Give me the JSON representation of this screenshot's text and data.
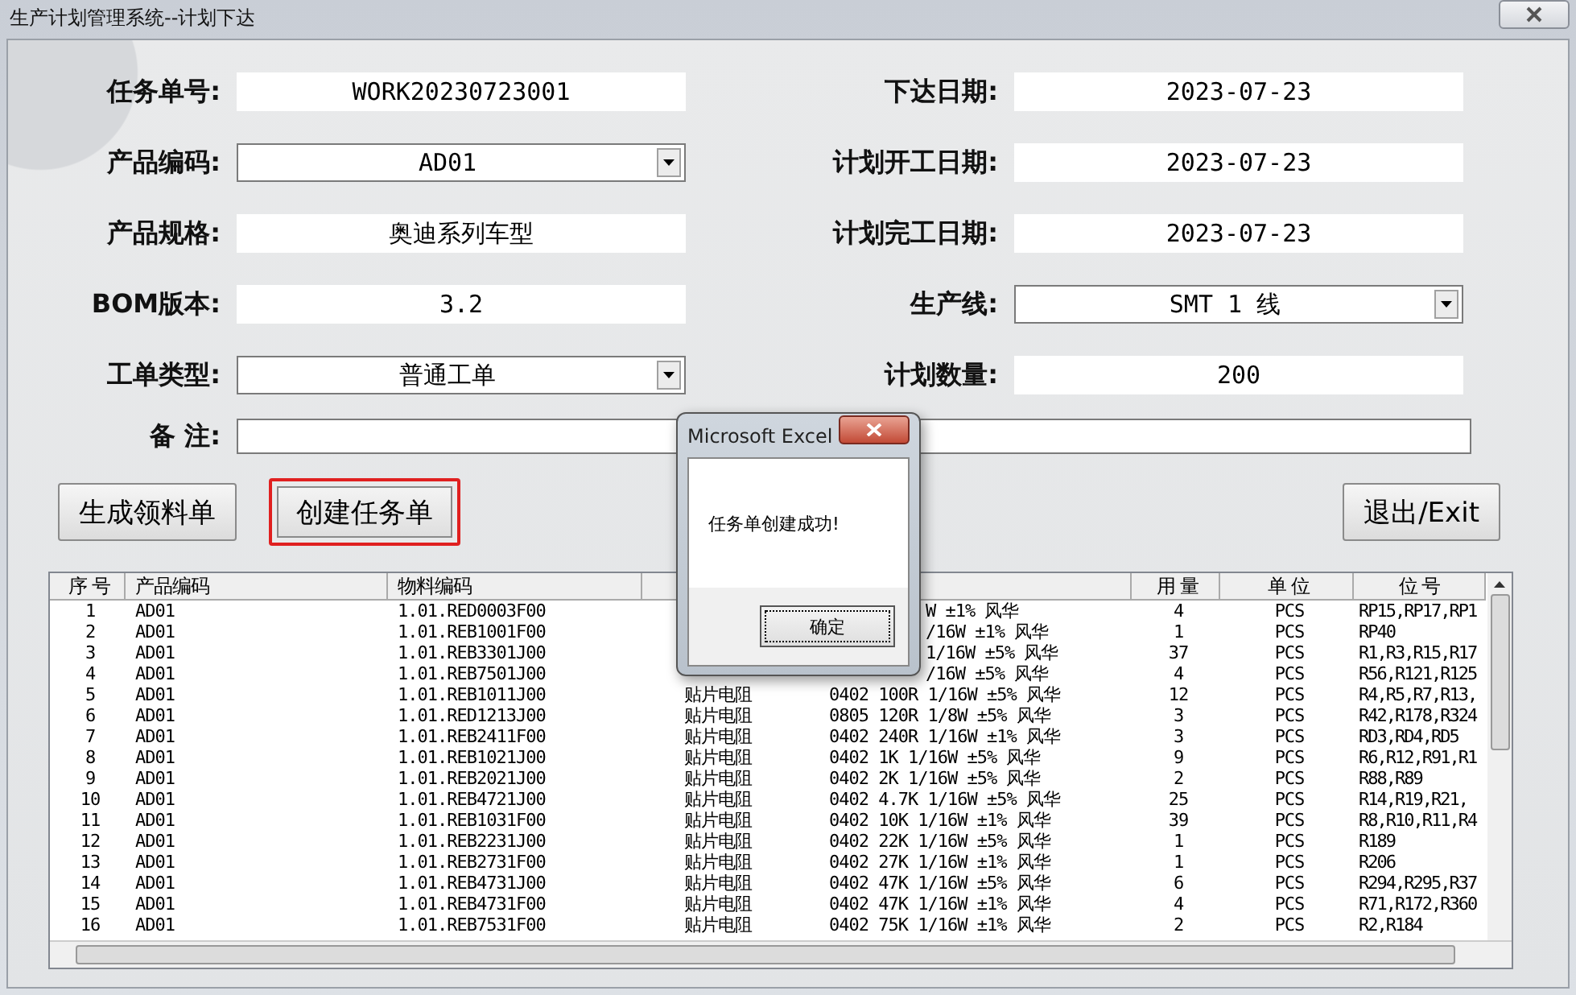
{
  "window": {
    "title": "生产计划管理系统--计划下达"
  },
  "form": {
    "left": [
      {
        "label": "任务单号:",
        "kind": "text",
        "value": "WORK20230723001"
      },
      {
        "label": "产品编码:",
        "kind": "dropdown",
        "value": "AD01"
      },
      {
        "label": "产品规格:",
        "kind": "text",
        "value": "奥迪系列车型"
      },
      {
        "label": "BOM版本:",
        "kind": "text",
        "value": "3.2"
      },
      {
        "label": "工单类型:",
        "kind": "dropdown",
        "value": "普通工单"
      }
    ],
    "right": [
      {
        "label": "下达日期:",
        "kind": "text",
        "value": "2023-07-23"
      },
      {
        "label": "计划开工日期:",
        "kind": "text",
        "value": "2023-07-23"
      },
      {
        "label": "计划完工日期:",
        "kind": "text",
        "value": "2023-07-23"
      },
      {
        "label": "生产线:",
        "kind": "dropdown",
        "value": "SMT 1 线"
      },
      {
        "label": "计划数量:",
        "kind": "text",
        "value": "200"
      }
    ],
    "memo": {
      "label": "备 注:"
    }
  },
  "buttons": [
    {
      "label": "生成领料单",
      "focused": false
    },
    {
      "label": "创建任务单",
      "focused": true
    },
    {
      "label": "退出/Exit",
      "focused": false
    }
  ],
  "table": {
    "columns": [
      "序 号",
      "产品编码",
      "物料编码",
      "用 量",
      "单 位",
      "位 号"
    ],
    "rows": [
      {
        "no": "1",
        "product": "AD01",
        "material": "1.01.RED0003F00",
        "spec": "W ±1% 风华",
        "qty": "4",
        "unit": "PCS",
        "position": "RP15,RP17,RP1"
      },
      {
        "no": "2",
        "product": "AD01",
        "material": "1.01.REB1001F00",
        "spec": "/16W ±1% 风华",
        "qty": "1",
        "unit": "PCS",
        "position": "RP40"
      },
      {
        "no": "3",
        "product": "AD01",
        "material": "1.01.REB3301J00",
        "spec": "1/16W ±5% 风华",
        "qty": "37",
        "unit": "PCS",
        "position": "R1,R3,R15,R17"
      },
      {
        "no": "4",
        "product": "AD01",
        "material": "1.01.REB7501J00",
        "spec": "/16W ±5% 风华",
        "qty": "4",
        "unit": "PCS",
        "position": "R56,R121,R125"
      },
      {
        "no": "5",
        "product": "AD01",
        "material": "1.01.REB1011J00",
        "name": "贴片电阻",
        "spec": "0402 100R 1/16W ±5% 风华",
        "qty": "12",
        "unit": "PCS",
        "position": "R4,R5,R7,R13,"
      },
      {
        "no": "6",
        "product": "AD01",
        "material": "1.01.RED1213J00",
        "name": "贴片电阻",
        "spec": "0805 120R 1/8W ±5% 风华",
        "qty": "3",
        "unit": "PCS",
        "position": "R42,R178,R324"
      },
      {
        "no": "7",
        "product": "AD01",
        "material": "1.01.REB2411F00",
        "name": "贴片电阻",
        "spec": "0402 240R 1/16W ±1% 风华",
        "qty": "3",
        "unit": "PCS",
        "position": "RD3,RD4,RD5"
      },
      {
        "no": "8",
        "product": "AD01",
        "material": "1.01.REB1021J00",
        "name": "贴片电阻",
        "spec": "0402 1K 1/16W ±5% 风华",
        "qty": "9",
        "unit": "PCS",
        "position": "R6,R12,R91,R1"
      },
      {
        "no": "9",
        "product": "AD01",
        "material": "1.01.REB2021J00",
        "name": "贴片电阻",
        "spec": "0402 2K 1/16W ±5% 风华",
        "qty": "2",
        "unit": "PCS",
        "position": "R88,R89"
      },
      {
        "no": "10",
        "product": "AD01",
        "material": "1.01.REB4721J00",
        "name": "贴片电阻",
        "spec": "0402 4.7K 1/16W ±5% 风华",
        "qty": "25",
        "unit": "PCS",
        "position": "R14,R19,R21,"
      },
      {
        "no": "11",
        "product": "AD01",
        "material": "1.01.REB1031F00",
        "name": "贴片电阻",
        "spec": "0402 10K 1/16W ±1% 风华",
        "qty": "39",
        "unit": "PCS",
        "position": "R8,R10,R11,R4"
      },
      {
        "no": "12",
        "product": "AD01",
        "material": "1.01.REB2231J00",
        "name": "贴片电阻",
        "spec": "0402 22K 1/16W ±5% 风华",
        "qty": "1",
        "unit": "PCS",
        "position": "R189"
      },
      {
        "no": "13",
        "product": "AD01",
        "material": "1.01.REB2731F00",
        "name": "贴片电阻",
        "spec": "0402 27K 1/16W ±1% 风华",
        "qty": "1",
        "unit": "PCS",
        "position": "R206"
      },
      {
        "no": "14",
        "product": "AD01",
        "material": "1.01.REB4731J00",
        "name": "贴片电阻",
        "spec": "0402 47K 1/16W ±5% 风华",
        "qty": "6",
        "unit": "PCS",
        "position": "R294,R295,R37"
      },
      {
        "no": "15",
        "product": "AD01",
        "material": "1.01.REB4731F00",
        "name": "贴片电阻",
        "spec": "0402 47K 1/16W ±1% 风华",
        "qty": "4",
        "unit": "PCS",
        "position": "R71,R172,R360"
      },
      {
        "no": "16",
        "product": "AD01",
        "material": "1.01.REB7531F00",
        "name": "贴片电阻",
        "spec": "0402 75K 1/16W ±1% 风华",
        "qty": "2",
        "unit": "PCS",
        "position": "R2,R184"
      }
    ]
  },
  "dialog": {
    "title": "Microsoft Excel",
    "message": "任务单创建成功!",
    "button": "确定"
  }
}
